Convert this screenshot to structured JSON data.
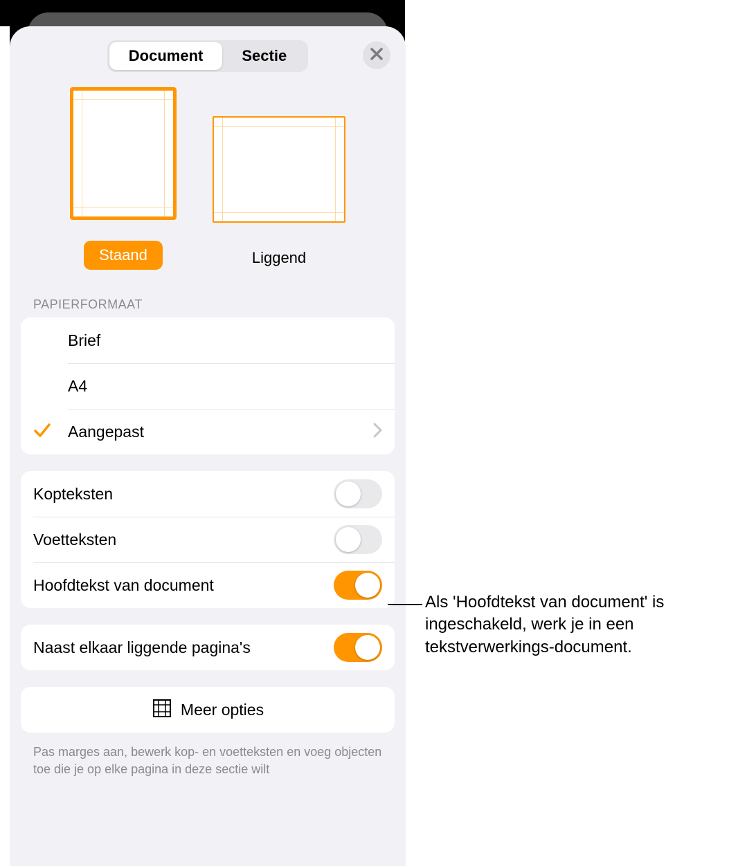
{
  "tabs": {
    "document": "Document",
    "section": "Sectie"
  },
  "orientation": {
    "portrait": "Staand",
    "landscape": "Liggend"
  },
  "paperSize": {
    "header": "PAPIERFORMAAT",
    "options": {
      "letter": "Brief",
      "a4": "A4",
      "custom": "Aangepast"
    }
  },
  "toggles": {
    "headers": "Kopteksten",
    "footers": "Voetteksten",
    "documentBody": "Hoofdtekst van document",
    "facingPages": "Naast elkaar liggende pagina's"
  },
  "moreOptions": "Meer opties",
  "caption": "Pas marges aan, bewerk kop- en voetteksten en voeg objecten toe die je op elke pagina in deze sectie wilt",
  "callout": "Als 'Hoofdtekst van document' is ingeschakeld, werk je in een tekstverwerkings-document."
}
